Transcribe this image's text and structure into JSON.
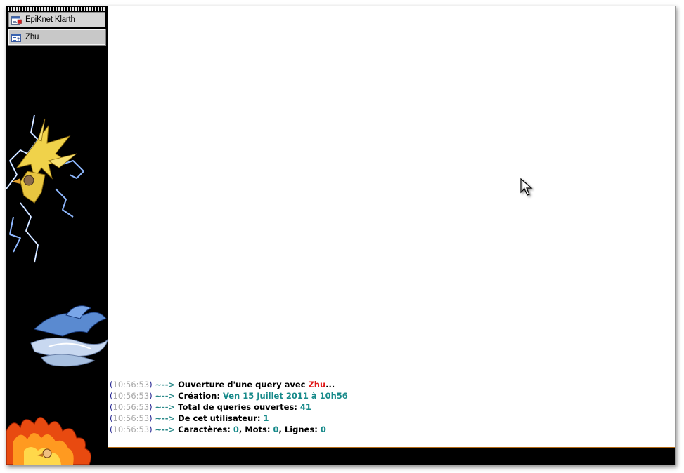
{
  "sidebar": {
    "items": [
      {
        "label": "EpiKnet Klarth",
        "icon": "server-window-icon",
        "active": false
      },
      {
        "label": "Zhu",
        "icon": "query-window-icon",
        "active": true
      }
    ],
    "artwork": [
      "lightning-bird-art",
      "ice-bird-art",
      "fire-bird-art"
    ]
  },
  "messages": [
    {
      "time": "10:56:53",
      "arrow": "~-->",
      "parts": [
        {
          "t": "txt",
          "v": "Ouverture d'une query avec "
        },
        {
          "t": "nick",
          "v": "Zhu"
        },
        {
          "t": "txt",
          "v": "..."
        }
      ]
    },
    {
      "time": "10:56:53",
      "arrow": "~-->",
      "parts": [
        {
          "t": "txt",
          "v": "Création: "
        },
        {
          "t": "val",
          "v": "Ven 15 Juillet 2011 à 10h56"
        }
      ]
    },
    {
      "time": "10:56:53",
      "arrow": "~-->",
      "parts": [
        {
          "t": "txt",
          "v": "Total de queries ouvertes: "
        },
        {
          "t": "val",
          "v": "41"
        }
      ]
    },
    {
      "time": "10:56:53",
      "arrow": "~-->",
      "parts": [
        {
          "t": "txt",
          "v": "De cet utilisateur: "
        },
        {
          "t": "val",
          "v": "1"
        }
      ]
    },
    {
      "time": "10:56:53",
      "arrow": "~-->",
      "parts": [
        {
          "t": "txt",
          "v": "Caractères: "
        },
        {
          "t": "val",
          "v": "0"
        },
        {
          "t": "txt",
          "v": ", Mots: "
        },
        {
          "t": "val",
          "v": "0"
        },
        {
          "t": "txt",
          "v": ", Lignes: "
        },
        {
          "t": "val",
          "v": "0"
        }
      ]
    }
  ],
  "input": {
    "value": ""
  },
  "colors": {
    "sidebar_bg": "#000000",
    "timestamp": "#a8a8a8",
    "paren": "#1a1a8c",
    "arrow": "#2b8a8a",
    "nick": "#e01818",
    "value": "#178a8a",
    "input_border": "#b46a16"
  }
}
